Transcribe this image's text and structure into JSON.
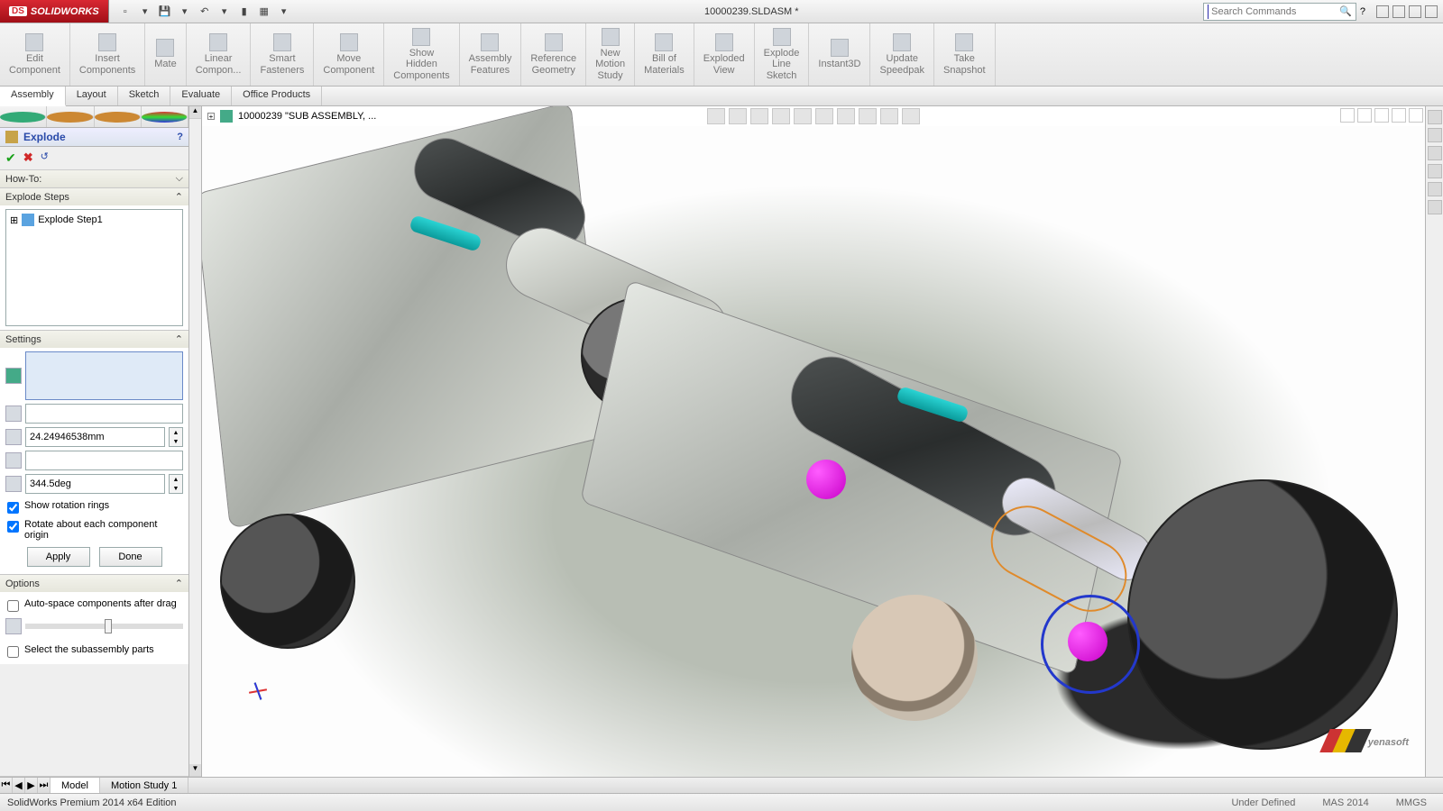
{
  "app": {
    "brand": "SOLIDWORKS",
    "title": "10000239.SLDASM *"
  },
  "search": {
    "placeholder": "Search Commands"
  },
  "ribbon": [
    {
      "l1": "Edit",
      "l2": "Component"
    },
    {
      "l1": "Insert",
      "l2": "Components"
    },
    {
      "l1": "Mate",
      "l2": ""
    },
    {
      "l1": "Linear",
      "l2": "Compon..."
    },
    {
      "l1": "Smart",
      "l2": "Fasteners"
    },
    {
      "l1": "Move",
      "l2": "Component"
    },
    {
      "l1": "Show",
      "l2": "Hidden",
      "l3": "Components"
    },
    {
      "l1": "Assembly",
      "l2": "Features"
    },
    {
      "l1": "Reference",
      "l2": "Geometry"
    },
    {
      "l1": "New",
      "l2": "Motion",
      "l3": "Study"
    },
    {
      "l1": "Bill of",
      "l2": "Materials"
    },
    {
      "l1": "Exploded",
      "l2": "View"
    },
    {
      "l1": "Explode",
      "l2": "Line",
      "l3": "Sketch"
    },
    {
      "l1": "Instant3D",
      "l2": ""
    },
    {
      "l1": "Update",
      "l2": "Speedpak"
    },
    {
      "l1": "Take",
      "l2": "Snapshot"
    }
  ],
  "tabs": [
    "Assembly",
    "Layout",
    "Sketch",
    "Evaluate",
    "Office Products"
  ],
  "active_tab": "Assembly",
  "panel": {
    "title": "Explode",
    "howto": "How-To:",
    "steps_hdr": "Explode Steps",
    "step1": "Explode Step1",
    "settings_hdr": "Settings",
    "dist": "24.24946538mm",
    "angle": "344.5deg",
    "show_rot": "Show rotation rings",
    "rotate_each": "Rotate about each component origin",
    "apply": "Apply",
    "done": "Done",
    "options_hdr": "Options",
    "autospace": "Auto-space components after drag",
    "selectsub": "Select the subassembly parts"
  },
  "doc_header": "10000239 \"SUB ASSEMBLY, ...",
  "bottom": {
    "tabs": [
      "Model",
      "Motion Study 1"
    ],
    "active": "Model"
  },
  "status": {
    "left": "SolidWorks Premium 2014 x64 Edition",
    "center": "Under Defined",
    "r1": "MAS 2014",
    "r2": "MMGS"
  },
  "watermark": "yenasoft"
}
